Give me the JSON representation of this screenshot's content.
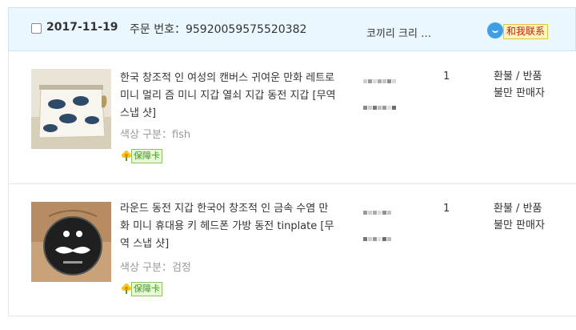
{
  "order": {
    "date": "2017-11-19",
    "order_number_label": "주문 번호：",
    "order_number": "95920059575520382",
    "seller_name": "코끼리 크리 …",
    "contact_label": "和我联系",
    "contact_icon": "chat-bubble-icon"
  },
  "items": [
    {
      "title": "한국 창조적 인 여성의 캔버스 귀여운 만화 레트로 미니 멀리 즘 미니 지갑 열쇠 지갑 동전 지갑 [무역 스냅 샷]",
      "variant": "색상 구분：fish",
      "guarantee_label": "保障卡",
      "quantity": "1",
      "action_refund": "환불 / 반품",
      "action_complaint": "불만 판매자"
    },
    {
      "title": "라운드 동전 지갑 한국어 창조적 인 금속 수염 만화 미니 휴대용 키 헤드폰 가방 동전 tinplate [무역 스냅 샷]",
      "variant": "색상 구분：검정",
      "guarantee_label": "保障卡",
      "quantity": "1",
      "action_refund": "환불 / 반품",
      "action_complaint": "불만 판매자"
    }
  ],
  "colors": {
    "header_bg": "#eaf7ff",
    "contact_text": "#c81d1d",
    "guarantee_text": "#3a9a1f"
  }
}
